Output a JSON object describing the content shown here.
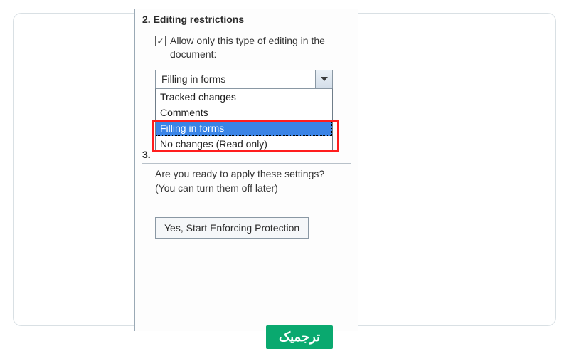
{
  "section2": {
    "title": "2. Editing restrictions",
    "checkbox_checked": true,
    "checkbox_glyph": "✓",
    "checkbox_label": "Allow only this type of editing in the document:"
  },
  "combo": {
    "selected": "Filling in forms",
    "options": [
      "Tracked changes",
      "Comments",
      "Filling in forms",
      "No changes (Read only)"
    ],
    "highlighted_index": 2
  },
  "section3": {
    "number": "3.",
    "prompt": "Are you ready to apply these settings? (You can turn them off later)",
    "button_label": "Yes, Start Enforcing Protection"
  },
  "brand": {
    "label": "ترجمیک"
  }
}
